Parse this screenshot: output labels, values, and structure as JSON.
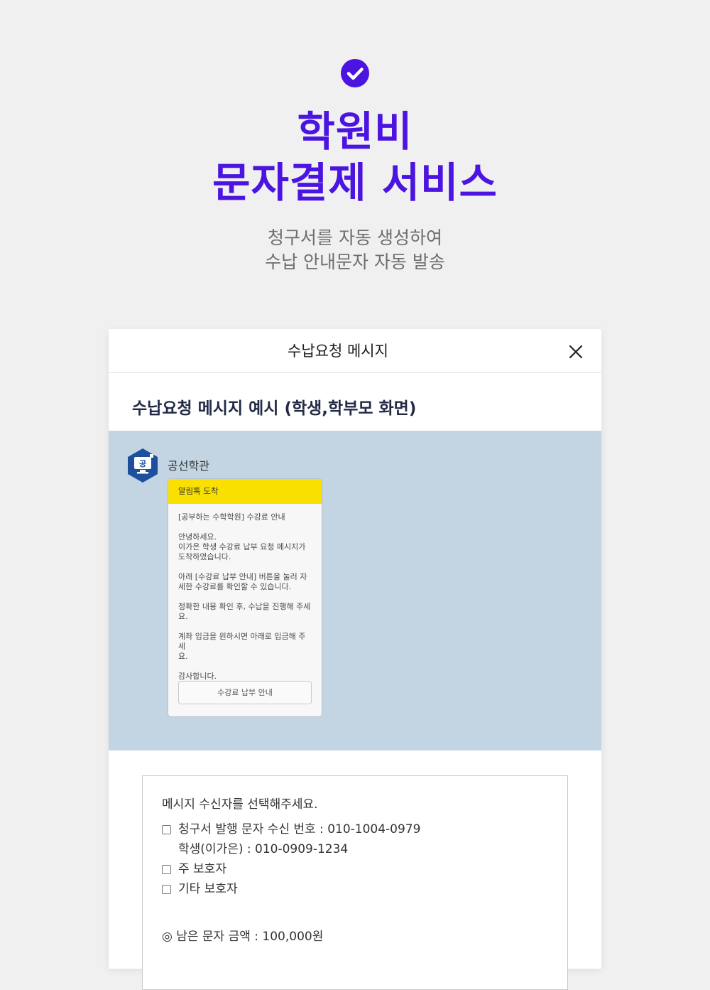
{
  "hero": {
    "title_line1": "학원비",
    "title_line2": "문자결제 서비스",
    "subtitle_line1": "청구서를 자동 생성하여",
    "subtitle_line2": "수납 안내문자 자동 발송",
    "accent_color": "#4b14e0",
    "icon": "check-circle-icon"
  },
  "modal": {
    "title": "수납요청 메시지",
    "close_icon": "close-icon",
    "section_title": "수납요청 메시지 예시 (학생,학부모 화면)",
    "preview": {
      "background_color": "#c3d4e2",
      "avatar_label": "공",
      "sender": "공선학관",
      "bubble_header": "알림톡 도착",
      "bubble_header_color": "#f9e000",
      "message": {
        "p1": "[공부하는 수학학원] 수강료 안내",
        "p2_l1": "안녕하세요.",
        "p2_l2": "이가은 학생 수강료 납부 요청 메시지가",
        "p2_l3": "도착하였습니다.",
        "p3_l1": "아래 [수강료 납부 안내] 버튼을 눌러 자",
        "p3_l2": "세한 수강료를 확인할 수 있습니다.",
        "p4_l1": "정확한 내용 확인 후, 수납을 진행해 주세",
        "p4_l2": "요.",
        "p5_l1": "계좌 입금을 원하시면 아래로 입금해 주세",
        "p5_l2": "요.",
        "p6": "감사합니다."
      },
      "button_label": "수강료 납부 안내"
    },
    "recipients": {
      "prompt": "메시지 수신자를  선택해주세요.",
      "option1": "청구서 발행 문자 수신 번호 : 010-1004-0979",
      "option1_sub": "학생(이가은) : 010-0909-1234",
      "option2": "주 보호자",
      "option3": "기타 보호자",
      "balance": "◎ 남은 문자 금액 : 100,000원"
    }
  }
}
